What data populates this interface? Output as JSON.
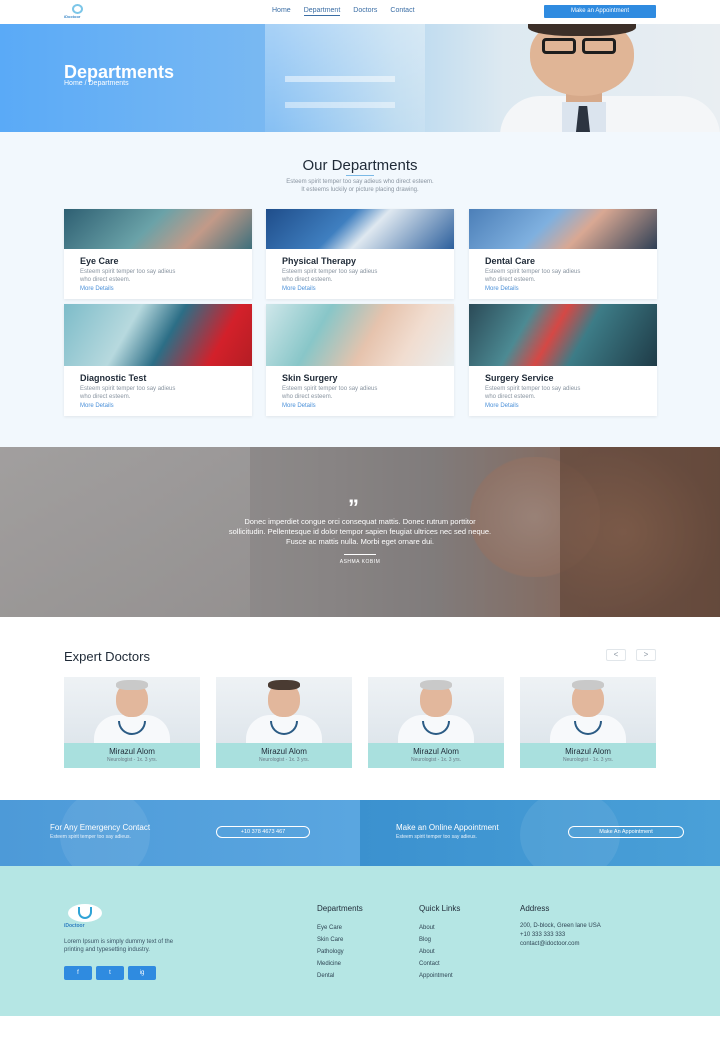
{
  "nav": {
    "logo_text": "iDoctoor",
    "links": [
      "Home",
      "Department",
      "Doctors",
      "Contact"
    ],
    "cta": "Make an Appointment"
  },
  "hero": {
    "title": "Departments",
    "breadcrumb": "Home / Departments"
  },
  "departments": {
    "title": "Our Departments",
    "subtitle_line1": "Esteem spirit temper too say adieus who direct esteem.",
    "subtitle_line2": "It esteems luckily or picture placing drawing.",
    "cards": [
      {
        "title": "Eye Care",
        "desc_line1": "Esteem spirit temper too say adieus",
        "desc_line2": "who direct esteem.",
        "link": "More Details"
      },
      {
        "title": "Physical Therapy",
        "desc_line1": "Esteem spirit temper too say adieus",
        "desc_line2": "who direct esteem.",
        "link": "More Details"
      },
      {
        "title": "Dental Care",
        "desc_line1": "Esteem spirit temper too say adieus",
        "desc_line2": "who direct esteem.",
        "link": "More Details"
      },
      {
        "title": "Diagnostic Test",
        "desc_line1": "Esteem spirit temper too say adieus",
        "desc_line2": "who direct esteem.",
        "link": "More Details"
      },
      {
        "title": "Skin Surgery",
        "desc_line1": "Esteem spirit temper too say adieus",
        "desc_line2": "who direct esteem.",
        "link": "More Details"
      },
      {
        "title": "Surgery Service",
        "desc_line1": "Esteem spirit temper too say adieus",
        "desc_line2": "who direct esteem.",
        "link": "More Details"
      }
    ]
  },
  "quote": {
    "mark": "”",
    "line1": "Donec imperdiet congue orci consequat mattis. Donec rutrum porttitor",
    "line2": "sollicitudin. Pellentesque id dolor tempor sapien feugiat ultrices nec sed neque.",
    "line3": "Fusce ac mattis nulla. Morbi eget ornare dui.",
    "author": "ASHMA KOBIM"
  },
  "doctors": {
    "title": "Expert Doctors",
    "prev": "<",
    "next": ">",
    "list": [
      {
        "name": "Mirazul Alom",
        "specialty": "Neurologist - 1x. 3 yrs."
      },
      {
        "name": "Mirazul Alom",
        "specialty": "Neurologist - 1x. 3 yrs."
      },
      {
        "name": "Mirazul Alom",
        "specialty": "Neurologist - 1x. 3 yrs."
      },
      {
        "name": "Mirazul Alom",
        "specialty": "Neurologist - 1x. 3 yrs."
      }
    ]
  },
  "cta": {
    "emergency_title": "For Any Emergency Contact",
    "emergency_sub": "Esteem spirit temper too say adieus.",
    "phone": "+10 378 4673 467",
    "appointment_title": "Make an Online Appointment",
    "appointment_sub": "Esteem spirit temper too say adieus.",
    "appointment_button": "Make An Appointment"
  },
  "footer": {
    "logo_text": "iDoctoor",
    "desc_line1": "Lorem Ipsum is simply dummy text of the",
    "desc_line2": "printing and typesetting industry.",
    "social": [
      "f",
      "t",
      "ig"
    ],
    "departments_title": "Departments",
    "departments": [
      "Eye Care",
      "Skin Care",
      "Pathology",
      "Medicine",
      "Dental"
    ],
    "quicklinks_title": "Quick Links",
    "quicklinks": [
      "About",
      "Blog",
      "About",
      "Contact",
      "Appointment"
    ],
    "address_title": "Address",
    "address": [
      "200, D-block, Green lane USA",
      "+10 333 333 333",
      "contact@idoctoor.com"
    ]
  },
  "colors": {
    "accent": "#2f8be0",
    "footer_bg": "#b5e6e4",
    "card_info_bg": "#a9e0de"
  }
}
